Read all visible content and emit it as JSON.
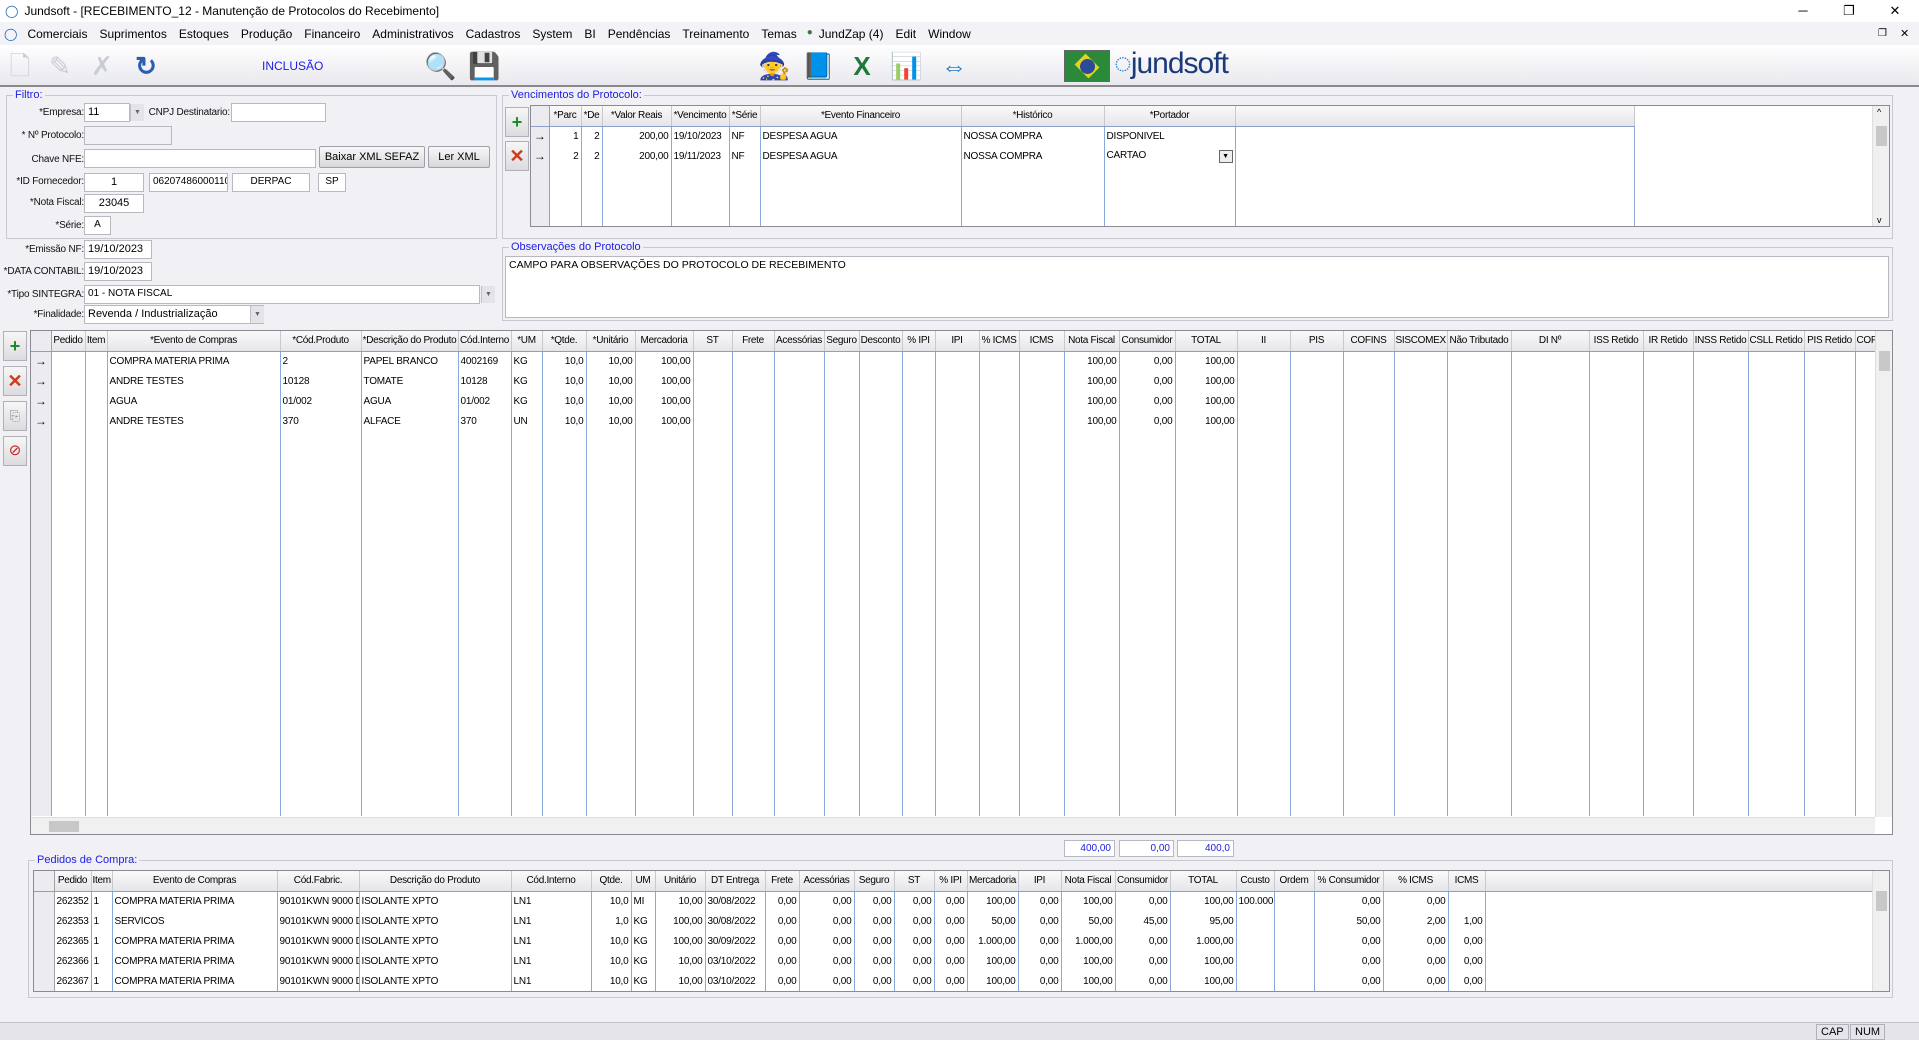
{
  "window": {
    "title": "Jundsoft - [RECEBIMENTO_12 - Manutenção de Protocolos do Recebimento]",
    "minimize": "─",
    "restore": "❐",
    "close": "✕"
  },
  "menu": {
    "items": [
      "Comerciais",
      "Suprimentos",
      "Estoques",
      "Produção",
      "Financeiro",
      "Administrativos",
      "Cadastros",
      "System",
      "BI",
      "Pendências",
      "Treinamento",
      "Temas",
      "JundZap (4)",
      "Edit",
      "Window"
    ]
  },
  "toolbar": {
    "mode": "INCLUSÃO",
    "logo": "jundsoft",
    "icons": [
      "new-icon",
      "edit-icon",
      "delete-icon",
      "refresh-icon",
      "search-icon",
      "save-icon",
      "wizard-icon",
      "help-book-icon",
      "excel-icon",
      "chart-icon",
      "teamviewer-icon",
      "brazil-flag-icon"
    ]
  },
  "filtro": {
    "title": "Filtro:",
    "empresa_label": "*Empresa:",
    "empresa": "11",
    "cnpj_label": "CNPJ Destinatario:",
    "cnpj": "",
    "protocolo_label": "* Nº Protocolo:",
    "protocolo": "",
    "chave_label": "Chave NFE:",
    "chave": "",
    "baixar_btn": "Baixar XML SEFAZ",
    "ler_btn": "Ler XML",
    "fornecedor_label": "*ID Fornecedor:",
    "fornecedor_id": "1",
    "fornecedor_cnpj": "06207486000110",
    "fornecedor_nome": "DERPAC",
    "fornecedor_uf": "SP",
    "nf_label": "*Nota Fiscal:",
    "nf": "23045",
    "serie_label": "*Série:",
    "serie": "A"
  },
  "dados": {
    "emissao_label": "*Emissão NF:",
    "emissao": "19/10/2023",
    "contabil_label": "*DATA CONTABIL:",
    "contabil": "19/10/2023",
    "sintegra_label": "*Tipo SINTEGRA:",
    "sintegra": "01 - NOTA FISCAL",
    "finalidade_label": "*Finalidade:",
    "finalidade": "Revenda / Industrialização"
  },
  "vencimentos": {
    "title": "Vencimentos do Protocolo:",
    "headers": [
      "*Parc",
      "*De",
      "*Valor Reais",
      "*Vencimento",
      "*Série",
      "*Evento Financeiro",
      "*Histórico",
      "*Portador"
    ],
    "rows": [
      [
        "1",
        "2",
        "200,00",
        "19/10/2023",
        "NF",
        "DESPESA AGUA",
        "NOSSA COMPRA",
        "DISPONIVEL"
      ],
      [
        "2",
        "2",
        "200,00",
        "19/11/2023",
        "NF",
        "DESPESA AGUA",
        "NOSSA COMPRA",
        "CARTAO"
      ]
    ]
  },
  "observacoes": {
    "title": "Observações do Protocolo",
    "text": "CAMPO PARA OBSERVAÇÕES DO PROTOCOLO DE RECEBIMENTO"
  },
  "itens": {
    "headers": [
      "Pedido",
      "Item",
      "*Evento de Compras",
      "*Cód.Produto",
      "*Descrição do Produto",
      "Cód.Interno",
      "*UM",
      "*Qtde.",
      "*Unitário",
      "Mercadoria",
      "ST",
      "Frete",
      "Acessórias",
      "Seguro",
      "Desconto",
      "% IPI",
      "IPI",
      "% ICMS",
      "ICMS",
      "Nota Fiscal",
      "Consumidor",
      "TOTAL",
      "II",
      "PIS",
      "COFINS",
      "SISCOMEX",
      "Não Tributado",
      "DI Nº",
      "ISS Retido",
      "IR Retido",
      "INSS Retido",
      "CSLL Retido",
      "PIS Retido",
      "COF"
    ],
    "rows": [
      [
        "",
        "",
        "COMPRA MATERIA PRIMA",
        "2",
        "PAPEL BRANCO",
        "4002169",
        "KG",
        "10,0",
        "10,00",
        "100,00",
        "",
        "",
        "",
        "",
        "",
        "",
        "",
        "",
        "",
        "100,00",
        "0,00",
        "100,00",
        "",
        "",
        "",
        "",
        "",
        "",
        "",
        "",
        "",
        "",
        "",
        ""
      ],
      [
        "",
        "",
        "ANDRE TESTES",
        "10128",
        "TOMATE",
        "10128",
        "KG",
        "10,0",
        "10,00",
        "100,00",
        "",
        "",
        "",
        "",
        "",
        "",
        "",
        "",
        "",
        "100,00",
        "0,00",
        "100,00",
        "",
        "",
        "",
        "",
        "",
        "",
        "",
        "",
        "",
        "",
        "",
        ""
      ],
      [
        "",
        "",
        "AGUA",
        "01/002",
        "AGUA",
        "01/002",
        "KG",
        "10,0",
        "10,00",
        "100,00",
        "",
        "",
        "",
        "",
        "",
        "",
        "",
        "",
        "",
        "100,00",
        "0,00",
        "100,00",
        "",
        "",
        "",
        "",
        "",
        "",
        "",
        "",
        "",
        "",
        "",
        ""
      ],
      [
        "",
        "",
        "ANDRE TESTES",
        "370",
        "ALFACE",
        "370",
        "UN",
        "10,0",
        "10,00",
        "100,00",
        "",
        "",
        "",
        "",
        "",
        "",
        "",
        "",
        "",
        "100,00",
        "0,00",
        "100,00",
        "",
        "",
        "",
        "",
        "",
        "",
        "",
        "",
        "",
        "",
        "",
        ""
      ]
    ],
    "totals": {
      "nota_fiscal": "400,00",
      "consumidor": "0,00",
      "total": "400,0"
    }
  },
  "pedidos": {
    "title": "Pedidos de Compra:",
    "headers": [
      "Pedido",
      "Item",
      "Evento de Compras",
      "Cód.Fabric.",
      "Descrição do Produto",
      "Cód.Interno",
      "Qtde.",
      "UM",
      "Unitário",
      "DT Entrega",
      "Frete",
      "Acessórias",
      "Seguro",
      "ST",
      "% IPI",
      "Mercadoria",
      "IPI",
      "Nota Fiscal",
      "Consumidor",
      "TOTAL",
      "Ccusto",
      "Ordem",
      "% Consumidor",
      "% ICMS",
      "ICMS"
    ],
    "rows": [
      [
        "262352",
        "1",
        "COMPRA MATERIA PRIMA",
        "90101KWN 9000 D",
        "ISOLANTE XPTO",
        "LN1",
        "10,0",
        "MI",
        "10,00",
        "30/08/2022",
        "0,00",
        "0,00",
        "0,00",
        "0,00",
        "0,00",
        "100,00",
        "0,00",
        "100,00",
        "0,00",
        "100,00",
        "100.000",
        "",
        "0,00",
        "0,00",
        ""
      ],
      [
        "262353",
        "1",
        "SERVICOS",
        "90101KWN 9000 D",
        "ISOLANTE XPTO",
        "LN1",
        "1,0",
        "KG",
        "100,00",
        "30/08/2022",
        "0,00",
        "0,00",
        "0,00",
        "0,00",
        "0,00",
        "50,00",
        "0,00",
        "50,00",
        "45,00",
        "95,00",
        "",
        "",
        "50,00",
        "2,00",
        "1,00"
      ],
      [
        "262365",
        "1",
        "COMPRA MATERIA PRIMA",
        "90101KWN 9000 D",
        "ISOLANTE XPTO",
        "LN1",
        "10,0",
        "KG",
        "100,00",
        "30/09/2022",
        "0,00",
        "0,00",
        "0,00",
        "0,00",
        "0,00",
        "1.000,00",
        "0,00",
        "1.000,00",
        "0,00",
        "1.000,00",
        "",
        "",
        "0,00",
        "0,00",
        "0,00"
      ],
      [
        "262366",
        "1",
        "COMPRA MATERIA PRIMA",
        "90101KWN 9000 D",
        "ISOLANTE XPTO",
        "LN1",
        "10,0",
        "KG",
        "10,00",
        "03/10/2022",
        "0,00",
        "0,00",
        "0,00",
        "0,00",
        "0,00",
        "100,00",
        "0,00",
        "100,00",
        "0,00",
        "100,00",
        "",
        "",
        "0,00",
        "0,00",
        "0,00"
      ],
      [
        "262367",
        "1",
        "COMPRA MATERIA PRIMA",
        "90101KWN 9000 D",
        "ISOLANTE XPTO",
        "LN1",
        "10,0",
        "KG",
        "10,00",
        "03/10/2022",
        "0,00",
        "0,00",
        "0,00",
        "0,00",
        "0,00",
        "100,00",
        "0,00",
        "100,00",
        "0,00",
        "100,00",
        "",
        "",
        "0,00",
        "0,00",
        "0,00"
      ]
    ]
  },
  "status": {
    "cap": "CAP",
    "num": "NUM"
  },
  "colors": {
    "accent": "#2020e0",
    "grid_line": "#8aa8d8"
  }
}
